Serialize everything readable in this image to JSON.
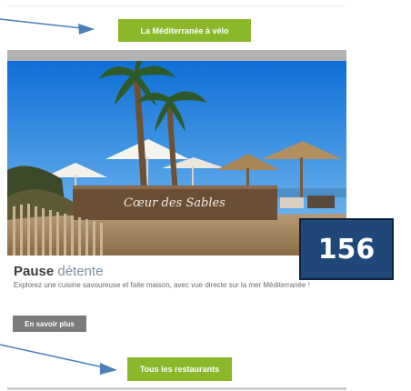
{
  "buttons": {
    "velo_label": "La Méditerranée à vélo",
    "restaurants_label": "Tous les restaurants",
    "more_label": "En savoir plus"
  },
  "card": {
    "title_strong": "Pause",
    "title_accent": " détente",
    "description": "Explorez une cuisine savoureuse et faite maison, avec vue directe sur la mer Méditerranée !",
    "sign_text": "Cœur des Sables"
  },
  "badge": {
    "number": "156"
  },
  "colors": {
    "accent_green": "#8ab82a",
    "badge_blue": "#1f4778",
    "arrow_blue": "#4a7fb8"
  },
  "icons": [
    "arrow-annotation-icon",
    "arrow-annotation-icon"
  ]
}
